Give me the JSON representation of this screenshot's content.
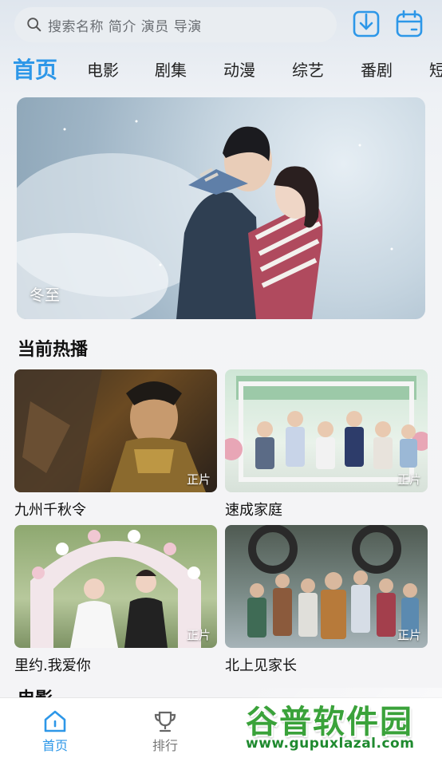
{
  "search": {
    "placeholder": "搜索名称 简介 演员 导演",
    "icon": "search-icon"
  },
  "header_icons": {
    "download": "download-icon",
    "calendar": "calendar-icon"
  },
  "tabs": [
    {
      "label": "首页",
      "active": true
    },
    {
      "label": "电影"
    },
    {
      "label": "剧集"
    },
    {
      "label": "动漫"
    },
    {
      "label": "综艺"
    },
    {
      "label": "番剧"
    },
    {
      "label": "短"
    }
  ],
  "banner": {
    "title": "冬至"
  },
  "hot_section": {
    "title": "当前热播",
    "items": [
      {
        "title": "九州千秋令",
        "badge": "正片"
      },
      {
        "title": "速成家庭",
        "badge": "正片"
      },
      {
        "title": "里约.我爱你",
        "badge": "正片"
      },
      {
        "title": "北上见家长",
        "badge": "正片"
      }
    ]
  },
  "movie_section": {
    "title": "电影"
  },
  "bottom_nav": {
    "items": [
      {
        "label": "首页",
        "icon": "home-icon",
        "active": true
      },
      {
        "label": "排行",
        "icon": "trophy-icon"
      }
    ]
  },
  "watermark": {
    "name": "谷普软件园",
    "url": "www.gupuxlazal.com"
  },
  "colors": {
    "accent": "#2d97e8",
    "text": "#111111",
    "watermark": "#3aa23a"
  }
}
